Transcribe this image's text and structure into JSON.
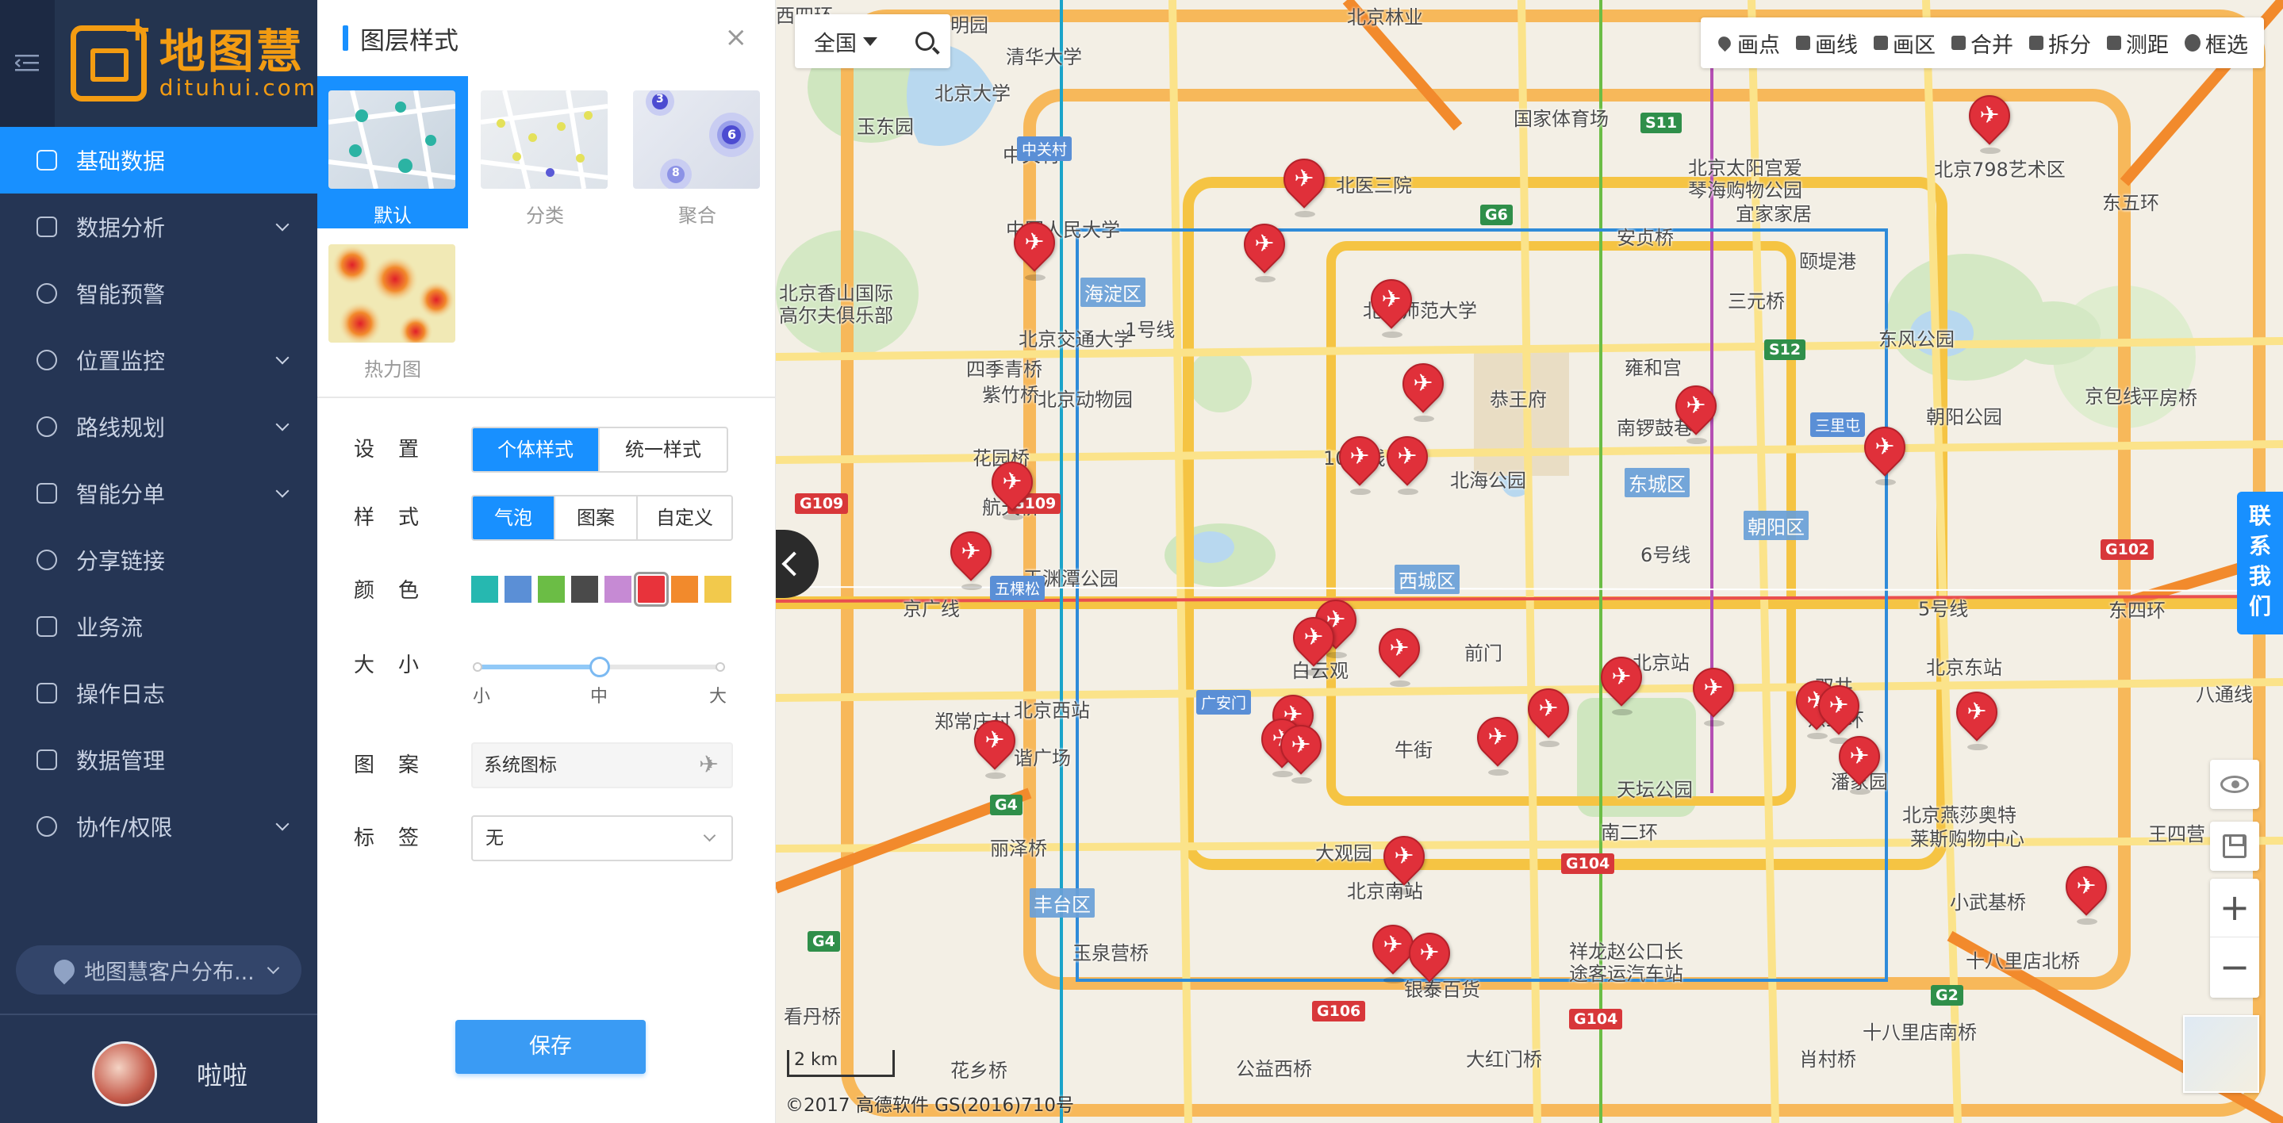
{
  "sidebar": {
    "logo": {
      "cn": "地图慧",
      "en": "dituhui.com"
    },
    "menu": [
      {
        "label": "基础数据",
        "active": true
      },
      {
        "label": "数据分析",
        "expandable": true
      },
      {
        "label": "智能预警"
      },
      {
        "label": "位置监控",
        "expandable": true
      },
      {
        "label": "路线规划",
        "expandable": true
      },
      {
        "label": "智能分单",
        "expandable": true
      },
      {
        "label": "分享链接"
      },
      {
        "label": "业务流"
      },
      {
        "label": "操作日志"
      },
      {
        "label": "数据管理"
      },
      {
        "label": "协作/权限",
        "expandable": true
      }
    ],
    "map_select": "地图慧客户分布...",
    "user": {
      "name": "啦啦"
    }
  },
  "panel": {
    "title": "图层样式",
    "close": "×",
    "styles": [
      {
        "label": "默认",
        "selected": true
      },
      {
        "label": "分类"
      },
      {
        "label": "聚合"
      },
      {
        "label": "热力图"
      }
    ],
    "cluster_counts": [
      "3",
      "6",
      "8"
    ],
    "settings": {
      "label": "设置",
      "options": [
        "个体样式",
        "统一样式"
      ],
      "selected": "个体样式"
    },
    "style": {
      "label": "样式",
      "options": [
        "气泡",
        "图案",
        "自定义"
      ],
      "selected": "气泡"
    },
    "color": {
      "label": "颜色",
      "swatches": [
        "#26b8b0",
        "#5b8fd6",
        "#6bbd45",
        "#4a4a4a",
        "#c68ad4",
        "#e8333b",
        "#f28a2c",
        "#f2c94c"
      ],
      "selected_index": 5
    },
    "size": {
      "label": "大小",
      "ticks": [
        "小",
        "中",
        "大"
      ],
      "value": "中",
      "value_fraction": 0.5
    },
    "pattern": {
      "label": "图案",
      "value": "系统图标"
    },
    "tag": {
      "label": "标签",
      "value": "无"
    },
    "save_label": "保存"
  },
  "map": {
    "region": "全国",
    "tools": [
      "画点",
      "画线",
      "画区",
      "合并",
      "拆分",
      "测距",
      "框选"
    ],
    "contact": [
      "联",
      "系",
      "我",
      "们"
    ],
    "zoom_in": "+",
    "zoom_out": "−",
    "scale": "2 km",
    "copyright": "©2017 高德软件 GS(2016)710号",
    "marker_icon": "airplane-icon",
    "marker_color": "#e0303a",
    "labels": [
      "圆明园",
      "清华大学",
      "北京林业",
      "北京大学",
      "玉东园",
      "国家体育场",
      "北京太阳宫爱",
      "琴海购物公园",
      "北京798艺术区",
      "中关村",
      "北医三院",
      "宜家家居",
      "中国人民大学",
      "安贞桥",
      "颐堤港",
      "北京香山国际",
      "高尔夫俱乐部",
      "北京师范大学",
      "三元桥",
      "东风公园",
      "四季青桥",
      "北京交通大学",
      "雍和宫",
      "紫竹桥",
      "北京动物园",
      "恭王府",
      "南锣鼓巷",
      "朝阳公园",
      "平房桥",
      "花园桥",
      "北海公园",
      "航天桥",
      "玉渊潭公园",
      "白云观",
      "北京西站",
      "北京站",
      "北京东站",
      "郑常庄村",
      "谐广场",
      "天坛公园",
      "南二环",
      "丽泽桥",
      "大观园",
      "北京南站",
      "北京燕莎奥特",
      "莱斯购物中心",
      "王四营",
      "小武基桥",
      "玉泉营桥",
      "十八里店北桥",
      "祥龙赵公口长",
      "途客运汽车站",
      "看丹桥",
      "十八里店南桥",
      "银泰百货",
      "大红门桥",
      "花乡桥",
      "公益西桥",
      "肖村桥",
      "前门",
      "牛街",
      "东二环",
      "潘家园",
      "双井",
      "东五环",
      "东四环",
      "京包线",
      "京广线",
      "1号线",
      "10号线",
      "6号线",
      "5号线",
      "八通线",
      "西四环"
    ],
    "districts": [
      "海淀区",
      "东城区",
      "朝阳区",
      "西城区",
      "丰台区"
    ],
    "road_shields_red": [
      "G109",
      "G109",
      "G102",
      "G104",
      "G104",
      "G106"
    ],
    "road_shields_green": [
      "S11",
      "G6",
      "S12",
      "G4",
      "G4",
      "G2"
    ],
    "road_shields_blue": [
      "中关村",
      "五棵松",
      "三里屯",
      "广安门"
    ]
  }
}
